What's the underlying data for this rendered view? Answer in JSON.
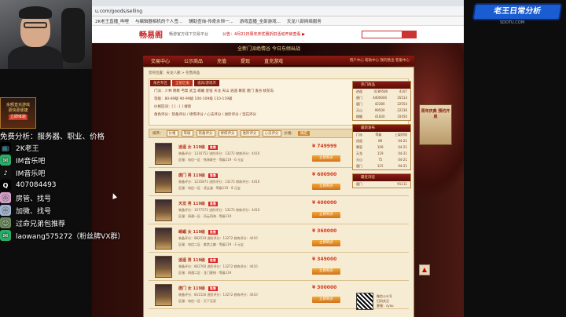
{
  "browser": {
    "url": "u.com/goods/selling",
    "bookmarks": [
      "2K老王直播_哔哩",
      "与编辑器相机的个人签...",
      "辅助查询-传奇永恒一...",
      "游戏直播_全部游戏...",
      "天龙八部网络服务"
    ]
  },
  "site": {
    "logo": "畅易阁",
    "logo_sub": "畅游官方线下交易平台",
    "notice": "公告：4月21日周年庆优惠折扣活动开启查看 ▶",
    "banner_text": "全新门派绝情谷 今日东倾出战"
  },
  "nav": {
    "items": [
      "交易中心",
      "公示商品",
      "充值",
      "提现",
      "直充游戏"
    ],
    "util": "用户中心  帮助中心  我的售出  客服中心"
  },
  "breadcrumb": "您的位置：天龙八部 > 在售商品",
  "filter": {
    "tabs": [
      "角色专区",
      "全部区服",
      "道具/游戏币"
    ],
    "rows": [
      "门派：少林  明教  丐帮  武当  峨嵋  星宿  天龙  天山  逍遥  慕容  唐门  鬼谷  桃花岛",
      "等级：80-89级  90-99级  100-109级  110-119级",
      "价格区间：[  ] - [  ]  搜索",
      "角色评分：装备评分 / 修炼评分 / 心法评分 / 进阶评分 / 宝石评分"
    ]
  },
  "sortbar": {
    "label": "排序：",
    "buttons": [
      "价格",
      "等级",
      "装备评分",
      "修炼评分",
      "进阶评分",
      "心法评分"
    ],
    "price_label": "价格：",
    "confirm": "确定"
  },
  "listings": [
    {
      "name": "逍遥  女  119级",
      "tag": "急售",
      "meta1": "装备评分：1316752    进阶评分：13272    修炼评分：4410",
      "meta2": "区服：电信一区 · 铁骑青空 · 等级119 · 6 元宝",
      "price": "¥ 749999",
      "buy": "立即购买"
    },
    {
      "name": "唐门  男  119级",
      "tag": "急售",
      "meta1": "装备评分：1235871    进阶评分：13272    修炼评分：4410",
      "meta2": "区服：电信一区 · 凌云渡 · 等级119 · 8 元宝",
      "price": "¥ 600900",
      "buy": "立即购买"
    },
    {
      "name": "天龙  男  119级",
      "tag": "急售",
      "meta1": "装备评分：1077571    进阶评分：13272    修炼评分：4410",
      "meta2": "区服：网通一区 · 风云四海 · 等级119",
      "price": "¥ 400000",
      "buy": "立即购买"
    },
    {
      "name": "峨嵋  女  119级",
      "tag": "急售",
      "meta1": "装备评分：882519    进阶评分：13272    修炼评分：4410",
      "meta2": "区服：电信二区 · 紫禁之巅 · 等级119 · 3 元宝",
      "price": "¥ 360000",
      "buy": "立即购买"
    },
    {
      "name": "逍遥  男  119级",
      "tag": "急售",
      "meta1": "装备评分：862760    进阶评分：13272    修炼评分：4410",
      "meta2": "区服：网通二区 · 龙门客栈 · 等级119",
      "price": "¥ 349000",
      "buy": "立即购买"
    },
    {
      "name": "唐门  女  119级",
      "tag": "急售",
      "meta1": "装备评分：841526    进阶评分：13272    修炼评分：4410",
      "meta2": "区服：电信一区 · 天下无双",
      "price": "¥ 300000",
      "buy": "立即购买"
    }
  ],
  "side": {
    "hot_title": "热门商品",
    "hot_rows": [
      [
        "逍遥",
        "4189580",
        "4107"
      ],
      [
        "唐门",
        "4400000",
        "35513"
      ],
      [
        "唐门",
        "42280",
        "22554"
      ],
      [
        "天山",
        "99500",
        "22236"
      ],
      [
        "峨嵋",
        "41830",
        "10450"
      ]
    ],
    "recent_title": "最新发布",
    "recent_rows": [
      [
        "门派",
        "等级",
        "上架时间"
      ],
      [
        "逍遥",
        "89",
        "04-21"
      ],
      [
        "慕容",
        "109",
        "04-21"
      ],
      [
        "天龙",
        "119",
        "04-21"
      ],
      [
        "天山",
        "75",
        "04-21"
      ],
      [
        "唐门",
        "115",
        "04-21"
      ]
    ],
    "browse_title": "最近浏览",
    "browse_rows": [
      [
        "唐门",
        "¥1111"
      ]
    ],
    "qr_text": "微信公众号\n扫码关注\n客服：cyou"
  },
  "poster_text": "周年庆典 预约开启",
  "overlay": {
    "ad_lines": [
      "余额直充游戏",
      "更快更便捷",
      "立即体验"
    ],
    "headline": "免费分析：服务器、职业、价格",
    "contacts": [
      {
        "icon": "bilibili-icon",
        "text": "2K老王",
        "color": "#000000"
      },
      {
        "icon": "wechat-icon",
        "text": "IM音乐吧",
        "color": "#2aae67"
      },
      {
        "icon": "douyin-icon",
        "text": "IM音乐吧",
        "color": "#111111"
      },
      {
        "icon": "qq-icon",
        "text": "407084493",
        "color": "#000000"
      },
      {
        "icon": "avatar-icon",
        "text": "房管、找号",
        "color": "#d7a0c9"
      },
      {
        "icon": "avatar-icon",
        "text": "加微、找号",
        "color": "#a0b7d7"
      },
      {
        "icon": "avatar-icon",
        "text": "过命兄弟包推荐",
        "color": "#6a8a5a"
      },
      {
        "icon": "wechat-icon",
        "text": "laowang575272（粉丝牌VX群）",
        "color": "#2aae67"
      }
    ],
    "badge": "老王日常分析",
    "badge_sub": "SDOTU.COM"
  },
  "colors": {
    "accent": "#8b1a12",
    "price": "#d2361b",
    "buy": "#d0711b"
  }
}
